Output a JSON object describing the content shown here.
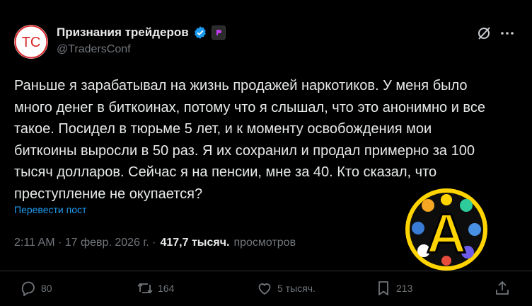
{
  "account": {
    "avatar_text": "TC",
    "display_name": "Признания трейдеров",
    "handle": "@TradersConf"
  },
  "tweet": {
    "text": "Раньше я зарабатывал на жизнь продажей наркотиков. У меня было\nмного денег в биткоинах, потому что я слышал, что это анонимно и все\nтакое. Посидел в тюрьме 5 лет, и к моменту освобождения мои\nбиткоины выросли в 50 раз. Я их сохранил и продал примерно за 100\nтысяч долларов. Сейчас я на пенсии, мне за 40. Кто сказал, что\nпреступление не окупается?",
    "translate_label": "Перевести пост",
    "time": "2:11 AM",
    "date": "17 февр. 2026 г.",
    "views_count": "417,7 тысяч.",
    "views_label": "просмотров"
  },
  "promo": {
    "letter": "A"
  },
  "actions": {
    "replies": "80",
    "reposts": "164",
    "likes": "5 тысяч.",
    "bookmarks": "213"
  },
  "colors": {
    "background": "#000000",
    "text": "#e7e9ea",
    "secondary": "#71767b",
    "link": "#1d9bf0",
    "verified": "#1d9bf0",
    "avatar_red": "#d7262a",
    "promo_yellow": "#ffd400"
  },
  "icons": {
    "verified": "verified-badge-icon",
    "app_badge": "app-badge-icon",
    "grok": "grok-icon",
    "more": "more-icon",
    "reply": "reply-icon",
    "repost": "repost-icon",
    "like": "heart-icon",
    "bookmark": "bookmark-icon",
    "share": "share-icon"
  }
}
